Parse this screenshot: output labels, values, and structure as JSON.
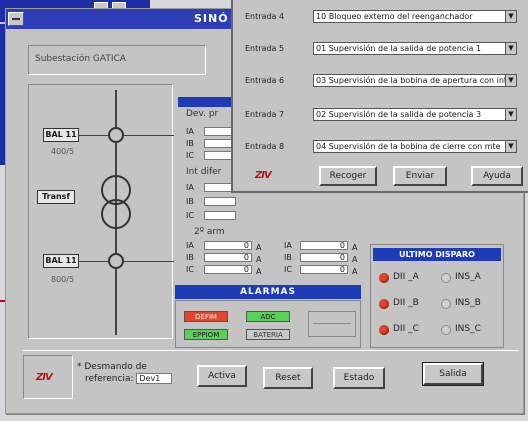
{
  "window": {
    "title": "SINÓ"
  },
  "substation": {
    "label": "Subestación GATICA"
  },
  "diagram": {
    "top_ct": {
      "label": "BAL 11",
      "ratio": "400/5"
    },
    "transformer": {
      "label": "Transf"
    },
    "bottom_ct": {
      "label": "BAL 11",
      "ratio": "800/5"
    }
  },
  "measurements": {
    "section1": "Dev. pr",
    "section2": "Int difer",
    "section3": "2º arm",
    "rows": [
      "IA",
      "IB",
      "IC"
    ],
    "harm_left": [
      "0",
      "0",
      "0"
    ],
    "harm_right": [
      "0",
      "0",
      "0"
    ],
    "unit": "A",
    "harm_right_labels": [
      "IA",
      "IB",
      "IC"
    ]
  },
  "alarms": {
    "header": "ALARMAS",
    "tags": [
      "DEFIM",
      "ADC",
      "EPPIOM",
      "BATERIA"
    ]
  },
  "last_trip": {
    "header": "ULTIMO DISPARO",
    "items": [
      {
        "label": "DII _A",
        "state": "on"
      },
      {
        "label": "INS_A",
        "state": "off"
      },
      {
        "label": "DII _B",
        "state": "on"
      },
      {
        "label": "INS_B",
        "state": "off"
      },
      {
        "label": "DII _C",
        "state": "on"
      },
      {
        "label": "INS_C",
        "state": "off"
      }
    ]
  },
  "bottom": {
    "logo": "ZIV",
    "note_line1": "* Desmando de",
    "note_line2": "referencia:",
    "ref_value": "Dev1",
    "buttons": {
      "activar": "Activa",
      "reset": "Reset",
      "estado": "Estado",
      "salida": "Salida"
    }
  },
  "dialog": {
    "inputs": [
      {
        "label": "Entrada 4",
        "value": "10 Bloqueo externo del reenganchador"
      },
      {
        "label": "Entrada 5",
        "value": "01 Supervisión de la salida de potencia 1"
      },
      {
        "label": "Entrada 6",
        "value": "03 Supervisión de la bobina de apertura con int"
      },
      {
        "label": "Entrada 7",
        "value": "02 Supervisión de la salida de potencia 3"
      },
      {
        "label": "Entrada 8",
        "value": "04 Supervisión de la bobina de cierre con mte"
      }
    ],
    "logo": "ZIV",
    "buttons": {
      "recoger": "Recoger",
      "enviar": "Enviar",
      "ayuda": "Ayuda"
    }
  }
}
